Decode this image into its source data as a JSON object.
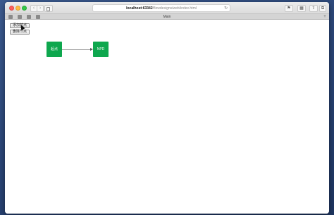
{
  "browser": {
    "url_host": "localhost:63342",
    "url_path": "/flowdesigns/web/index.html",
    "tab_title": "Main"
  },
  "page": {
    "button_1_label": "添加节点",
    "button_2_label": "删除节点"
  },
  "nodes": {
    "start_label": "起点",
    "end_label": "NPD"
  },
  "colors": {
    "node": "#0ea74e",
    "edge": "#9a9a9a"
  }
}
